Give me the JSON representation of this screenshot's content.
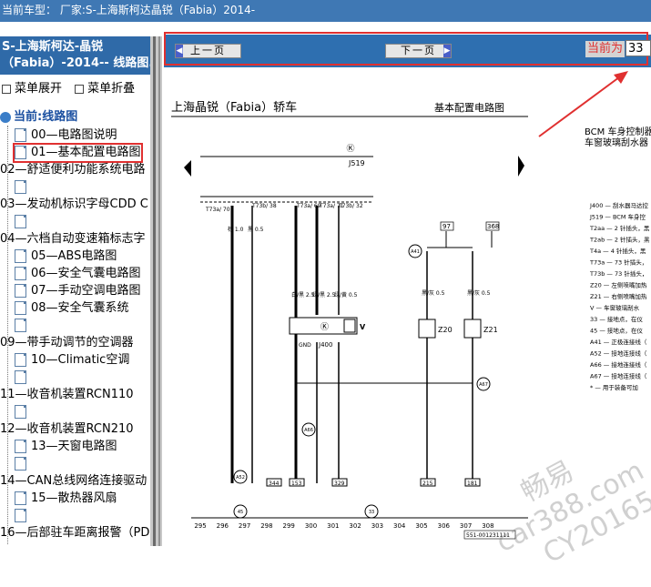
{
  "topbar": {
    "text": "当前车型：   厂家:S-上海斯柯达晶锐（Fabia）2014-"
  },
  "sidebar": {
    "title_line1": "S-上海斯柯达-晶锐",
    "title_line2": "（Fabia）-2014-- 线路图.",
    "expand_label": "菜单展开",
    "collapse_label": "菜单折叠",
    "root_label": "当前:线路图",
    "items": [
      {
        "label": "00—电路图说明"
      },
      {
        "label": "01—基本配置电路图"
      },
      {
        "label": "02—舒适便利功能系统电路"
      },
      {
        "label": ""
      },
      {
        "label": "03—发动机标识字母CDD C"
      },
      {
        "label": ""
      },
      {
        "label": "04—六档自动变速箱标志字"
      },
      {
        "label": "05—ABS电路图"
      },
      {
        "label": "06—安全气囊电路图"
      },
      {
        "label": "07—手动空调电路图"
      },
      {
        "label": "08—安全气囊系统"
      },
      {
        "label": ""
      },
      {
        "label": "09—带手动调节的空调器"
      },
      {
        "label": "10—Climatic空调"
      },
      {
        "label": ""
      },
      {
        "label": "11—收音机装置RCN110"
      },
      {
        "label": ""
      },
      {
        "label": "12—收音机装置RCN210"
      },
      {
        "label": "13—天窗电路图"
      },
      {
        "label": ""
      },
      {
        "label": "14—CAN总线网络连接驱动"
      },
      {
        "label": "15—散热器风扇"
      },
      {
        "label": ""
      },
      {
        "label": "16—后部驻车距离报警（PD"
      }
    ]
  },
  "nav": {
    "prev_label": "上一页",
    "next_label": "下一页",
    "current_label": "当前为",
    "current_value": "33"
  },
  "diagram": {
    "title": "上海晶锐（Fabia）轿车",
    "subtitle": "基本配置电路图",
    "right_header_1": "BCM 车身控制器",
    "right_header_2": "车窗玻璃刮水器",
    "legend": [
      "J400 — 刮水器马达控",
      "J519 — BCM 车身控",
      "T2aa — 2 针插头，黑",
      "T2ab — 2 针插头，黑",
      "T4a — 4 针插头，黑",
      "T73a — 73 针插头，",
      "T73b — 73 针插头，",
      "Z20 — 左侧喷嘴加热",
      "Z21 — 右侧喷嘴加热",
      "V — 车窗玻璃刮水",
      "33 — 接地点，在仪",
      "45 — 接地点，在仪",
      "A41 — 正极连接线（",
      "A52 — 接地连接线（",
      "A66 — 接地连接线（",
      "A67 — 接地连接线（",
      "* — 用于装备可加"
    ],
    "top_labels": [
      "T73a/ 70",
      "T73b/ 38",
      "T73a/ 69",
      "T73a/ 71",
      "T73b/ 32",
      "97",
      "368"
    ],
    "wire_colors": [
      "棕 1.0",
      "黑 0.5",
      "白/黑 2.5",
      "绿/黑 2.5",
      "绿/黄 0.5",
      "黑/灰 0.5",
      "黑/灰 0.5"
    ],
    "module_labels": {
      "j519": "J519",
      "j400": "J400",
      "v": "V",
      "z20": "Z20",
      "z21": "Z21",
      "gnd": "GND"
    },
    "bottom_boxes": [
      "344",
      "153",
      "329",
      "215",
      "181"
    ],
    "ground_labels": [
      "A52",
      "A66",
      "A67",
      "A41",
      "45",
      "33"
    ],
    "axis_numbers": [
      "295",
      "296",
      "297",
      "298",
      "299",
      "300",
      "301",
      "302",
      "303",
      "304",
      "305",
      "306",
      "307",
      "308"
    ],
    "doc_number": "551-001231111",
    "watermark_1": "畅易",
    "watermark_2": "car388.com",
    "watermark_3": "CY20165"
  }
}
